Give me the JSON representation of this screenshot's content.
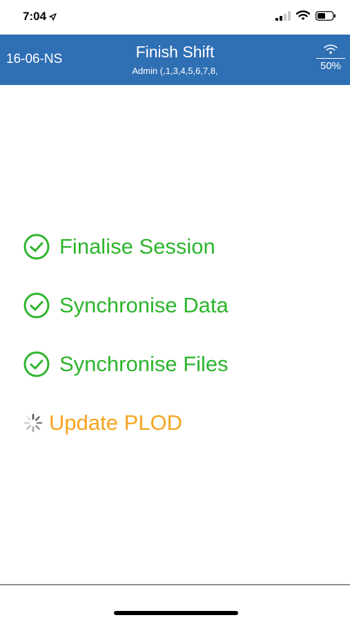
{
  "status_bar": {
    "time": "7:04"
  },
  "header": {
    "device_id": "16-06-NS",
    "title": "Finish Shift",
    "subtitle": "Admin (,1,3,4,5,6,7,8,",
    "signal_percent": "50%"
  },
  "steps": [
    {
      "label": "Finalise Session",
      "state": "done",
      "icon": "check-circle-icon"
    },
    {
      "label": "Synchronise Data",
      "state": "done",
      "icon": "check-circle-icon"
    },
    {
      "label": "Synchronise Files",
      "state": "done",
      "icon": "check-circle-icon"
    },
    {
      "label": "Update PLOD",
      "state": "in-progress",
      "icon": "spinner-icon"
    }
  ],
  "colors": {
    "header_bg": "#2f6fb4",
    "done": "#2cb52c",
    "pending": "#f5a41f"
  }
}
